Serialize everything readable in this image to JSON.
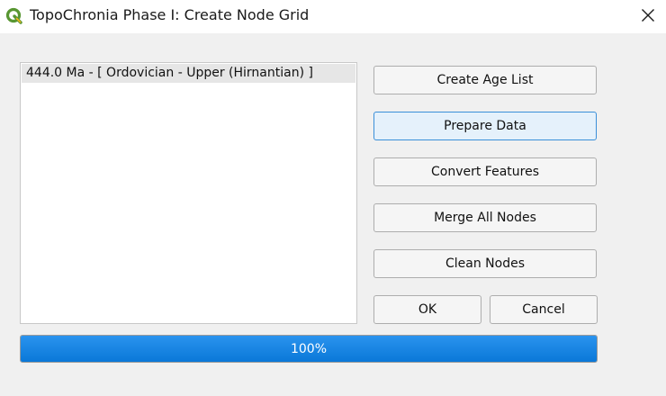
{
  "window": {
    "title": "TopoChronia Phase I: Create Node Grid",
    "app_icon": "qgis-icon",
    "close_icon": "close-icon"
  },
  "list": {
    "items": [
      "444.0 Ma - [ Ordovician - Upper (Hirnantian) ]"
    ]
  },
  "buttons": {
    "create_age_list": "Create Age List",
    "prepare_data": "Prepare Data",
    "convert_features": "Convert Features",
    "merge_all_nodes": "Merge All Nodes",
    "clean_nodes": "Clean Nodes",
    "ok": "OK",
    "cancel": "Cancel"
  },
  "progress": {
    "value": 100,
    "label": "100%"
  },
  "colors": {
    "progress_fill": "#0a78d8",
    "focus_border": "#3a8fd9",
    "qgis_green": "#589632",
    "qgis_yellow": "#f0b41a"
  }
}
